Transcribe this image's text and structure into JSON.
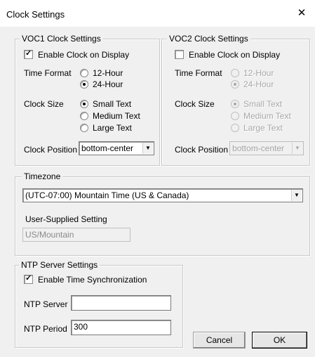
{
  "window": {
    "title": "Clock Settings",
    "close_glyph": "✕"
  },
  "voc1": {
    "legend": "VOC1 Clock Settings",
    "enable_label": "Enable Clock on Display",
    "enable_checked": true,
    "time_format_label": "Time Format",
    "time_format_options": [
      "12-Hour",
      "24-Hour"
    ],
    "time_format_selected": "24-Hour",
    "clock_size_label": "Clock Size",
    "clock_size_options": [
      "Small Text",
      "Medium Text",
      "Large Text"
    ],
    "clock_size_selected": "Small Text",
    "position_label": "Clock Position",
    "position_value": "bottom-center"
  },
  "voc2": {
    "legend": "VOC2 Clock Settings",
    "enable_label": "Enable Clock on Display",
    "enable_checked": false,
    "time_format_label": "Time Format",
    "time_format_options": [
      "12-Hour",
      "24-Hour"
    ],
    "time_format_selected": "24-Hour",
    "clock_size_label": "Clock Size",
    "clock_size_options": [
      "Small Text",
      "Medium Text",
      "Large Text"
    ],
    "clock_size_selected": "Small Text",
    "position_label": "Clock Position",
    "position_value": "bottom-center"
  },
  "timezone": {
    "legend": "Timezone",
    "value": "(UTC-07:00) Mountain Time (US & Canada)",
    "user_label": "User-Supplied Setting",
    "user_value": "US/Mountain"
  },
  "ntp": {
    "legend": "NTP Server Settings",
    "enable_label": "Enable Time Synchronization",
    "enable_checked": true,
    "server_label": "NTP Server",
    "server_value": "",
    "period_label": "NTP Period",
    "period_value": "300"
  },
  "buttons": {
    "cancel": "Cancel",
    "ok": "OK"
  },
  "icons": {
    "check": "check-icon",
    "dropdown": "chevron-down-icon",
    "close": "close-icon"
  }
}
